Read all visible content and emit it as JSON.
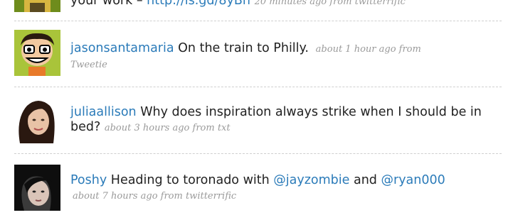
{
  "tweets": [
    {
      "user": "",
      "text_before_link": "your work –",
      "link": "http://is.gd/8yBn",
      "meta": "20 minutes ago from twitterrific"
    },
    {
      "user": "jasonsantamaria",
      "text": "On the train to Philly.",
      "meta_line1": "about 1 hour ago from",
      "meta_line2": "Tweetie"
    },
    {
      "user": "juliaallison",
      "text": "Why does inspiration always strike when I should be in bed?",
      "meta": "about 3 hours ago from txt"
    },
    {
      "user": "Poshy",
      "text_before": "Heading to toronado with",
      "mention1": "@jayzombie",
      "and": "and",
      "mention2": "@ryan000",
      "meta": "about 7 hours ago from twitterrific"
    }
  ],
  "colors": {
    "link": "#2b7bb9",
    "text": "#222222",
    "meta": "#9a9a9a",
    "separator": "#cfcfcf"
  },
  "icons": {
    "avatar_1": "avatar-partial-green",
    "avatar_2": "avatar-cartoon-face",
    "avatar_3": "avatar-woman-photo",
    "avatar_4": "avatar-dark-hair-photo"
  }
}
